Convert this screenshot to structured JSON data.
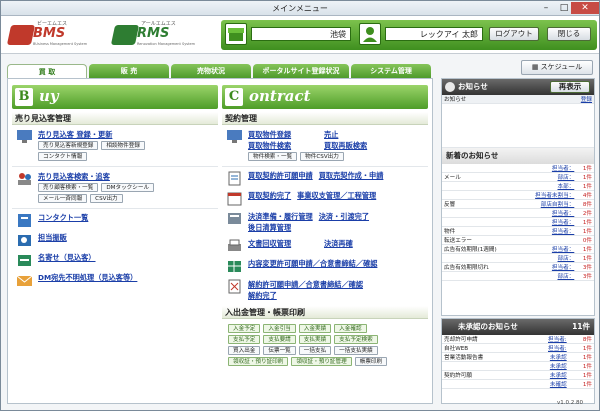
{
  "window": {
    "title": "メインメニュー",
    "min": "–",
    "max": "□",
    "close": "✕"
  },
  "logos": [
    {
      "name": "BMS",
      "kana": "ビーエムエス",
      "sub": "BUsiness Management System",
      "color": "#c0392b"
    },
    {
      "name": "RMS",
      "kana": "アールエムエス",
      "sub": "Renovation Management System",
      "color": "#2e7d32"
    }
  ],
  "header": {
    "store": "池袋",
    "user": "レックアイ 太郎",
    "login_label": "ログアウト",
    "close_label": "閉じる"
  },
  "tabs": [
    "買 取",
    "販 売",
    "売物状況",
    "ポータルサイト登録状況",
    "システム管理"
  ],
  "schedule_label": "スケジュール",
  "buy": {
    "banner_letter": "B",
    "banner_text": "uy",
    "section": "売り見込客管理",
    "g1": {
      "main": [
        "売り見込客 登録・更新"
      ],
      "subs": [
        "売り見込客新規登録",
        "相談物件登録",
        "コンタクト情報"
      ]
    },
    "g2": {
      "main": [
        "売り見込客検索・追客"
      ],
      "subs": [
        "売り顧客検索・一覧",
        "DMタックシール",
        "メール一斉同報",
        "CSV出力"
      ]
    },
    "links": [
      "コンタクト一覧",
      "担当振販",
      "名寄せ（見込客）",
      "DM宛先不明処理（見込客等）"
    ]
  },
  "contract": {
    "banner_letter": "C",
    "banner_text": "ontract",
    "section": "契約管理",
    "g1": {
      "main": [
        "買取物件登録",
        "売止",
        "買取物件検索",
        "買取再販検索"
      ],
      "subs": [
        "物件検索・一覧",
        "物件CSV出力"
      ]
    },
    "rows": [
      [
        "買取契約許可願申請",
        "買取売契作成・申請"
      ],
      [
        "買取契約完了",
        "事業収支管理／工程管理"
      ],
      [
        "決済準備・履行管理",
        "決済・引渡完了",
        "後日清算管理"
      ],
      [
        "文書回収管理",
        "決済再確"
      ],
      [
        "内容変更許可願申請／合意書締結／確認"
      ],
      [
        "解約許可願申請／合意書締結／確認",
        "解約完了"
      ]
    ],
    "section2": "入出金管理・帳票印刷",
    "pay_buttons": [
      "入金予定",
      "入金引当",
      "入金実績",
      "入金確認",
      "支払予定",
      "支払要請",
      "支払実績",
      "支払予定検索",
      "買入出金",
      "伝票一覧",
      "一括支払",
      "一括支払実績",
      "領収証・預り証印刷",
      "領収証・預り証管理",
      "帳票印刷"
    ]
  },
  "notice": {
    "title": "お知らせ",
    "redisplay": "再表示",
    "col": "お知らせ",
    "link": "登録",
    "new_title": "新着のお知らせ",
    "rows": [
      {
        "cat": "",
        "label": "担当者：",
        "count": "1件"
      },
      {
        "cat": "メール",
        "label": "部店：",
        "count": "1件"
      },
      {
        "cat": "",
        "label": "本部：",
        "count": "1件"
      },
      {
        "cat": "",
        "label": "担当者未割当：",
        "count": "4件"
      },
      {
        "cat": "反響",
        "label": "部店自割当：",
        "count": "8件"
      },
      {
        "cat": "",
        "label": "担当者：",
        "count": "2件"
      },
      {
        "cat": "",
        "label": "担当者：",
        "count": "1件"
      },
      {
        "cat": "物件",
        "label": "担当者：",
        "count": "1件"
      },
      {
        "cat": "転送エラー",
        "label": "",
        "count": "0件"
      },
      {
        "cat": "広告有効期限(1週間)",
        "label": "担当者：",
        "count": "1件"
      },
      {
        "cat": "",
        "label": "部店：",
        "count": "1件"
      },
      {
        "cat": "広告有効期限切れ",
        "label": "担当者：",
        "count": "3件"
      },
      {
        "cat": "",
        "label": "部店：",
        "count": "3件"
      }
    ]
  },
  "pending": {
    "title": "未承認のお知らせ",
    "count_badge": "11件",
    "rows": [
      {
        "cat": "売却許可申請",
        "label": "担当者:",
        "count": "8件"
      },
      {
        "cat": "自社WEB",
        "label": "担当者:",
        "count": "1件"
      },
      {
        "cat": "営業活動報告書",
        "label": "未承認",
        "count": "1件"
      },
      {
        "cat": "",
        "label": "未承認",
        "count": "1件"
      },
      {
        "cat": "契約許可願",
        "label": "未承認",
        "count": "1件"
      },
      {
        "cat": "",
        "label": "未確認",
        "count": "1件"
      }
    ]
  },
  "version": "v1.0.2.80"
}
